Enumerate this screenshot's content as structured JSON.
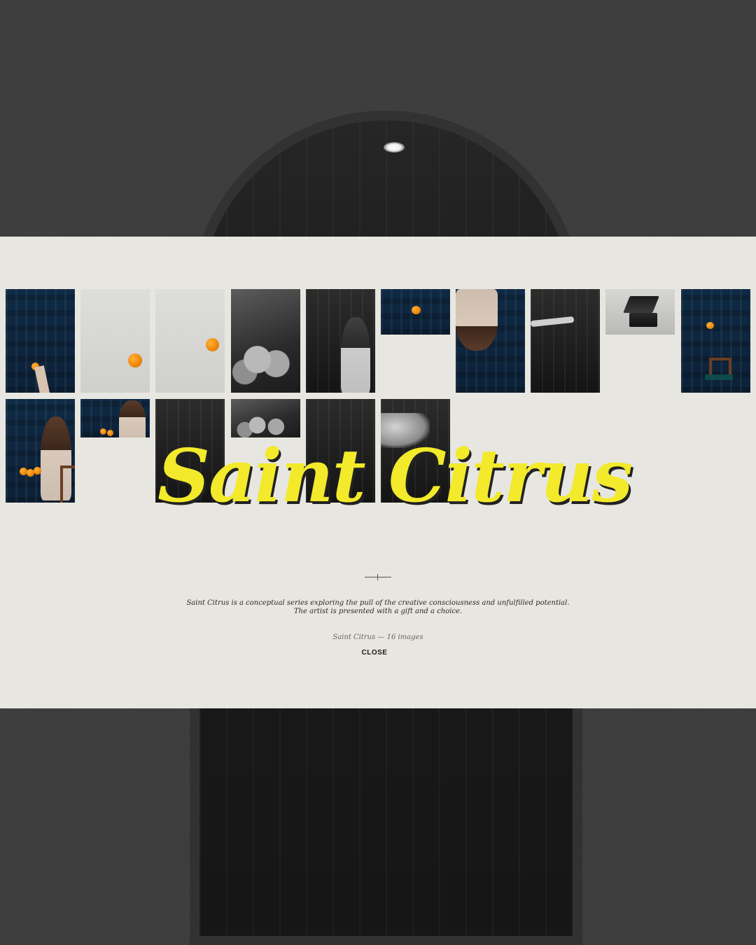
{
  "series": {
    "title": "Saint Citrus",
    "description_lines": [
      "Saint Citrus is a conceptual series exploring the pull of the creative consciousness and unfulfilled potential.",
      "The artist is presented with a gift and a choice."
    ],
    "meta_label": "Saint Citrus — 16 images",
    "close_label": "CLOSE",
    "image_count": 16
  },
  "colors": {
    "title": "#f2ea2b",
    "panel": "#e8e6e0",
    "background": "#3d3d3d"
  }
}
